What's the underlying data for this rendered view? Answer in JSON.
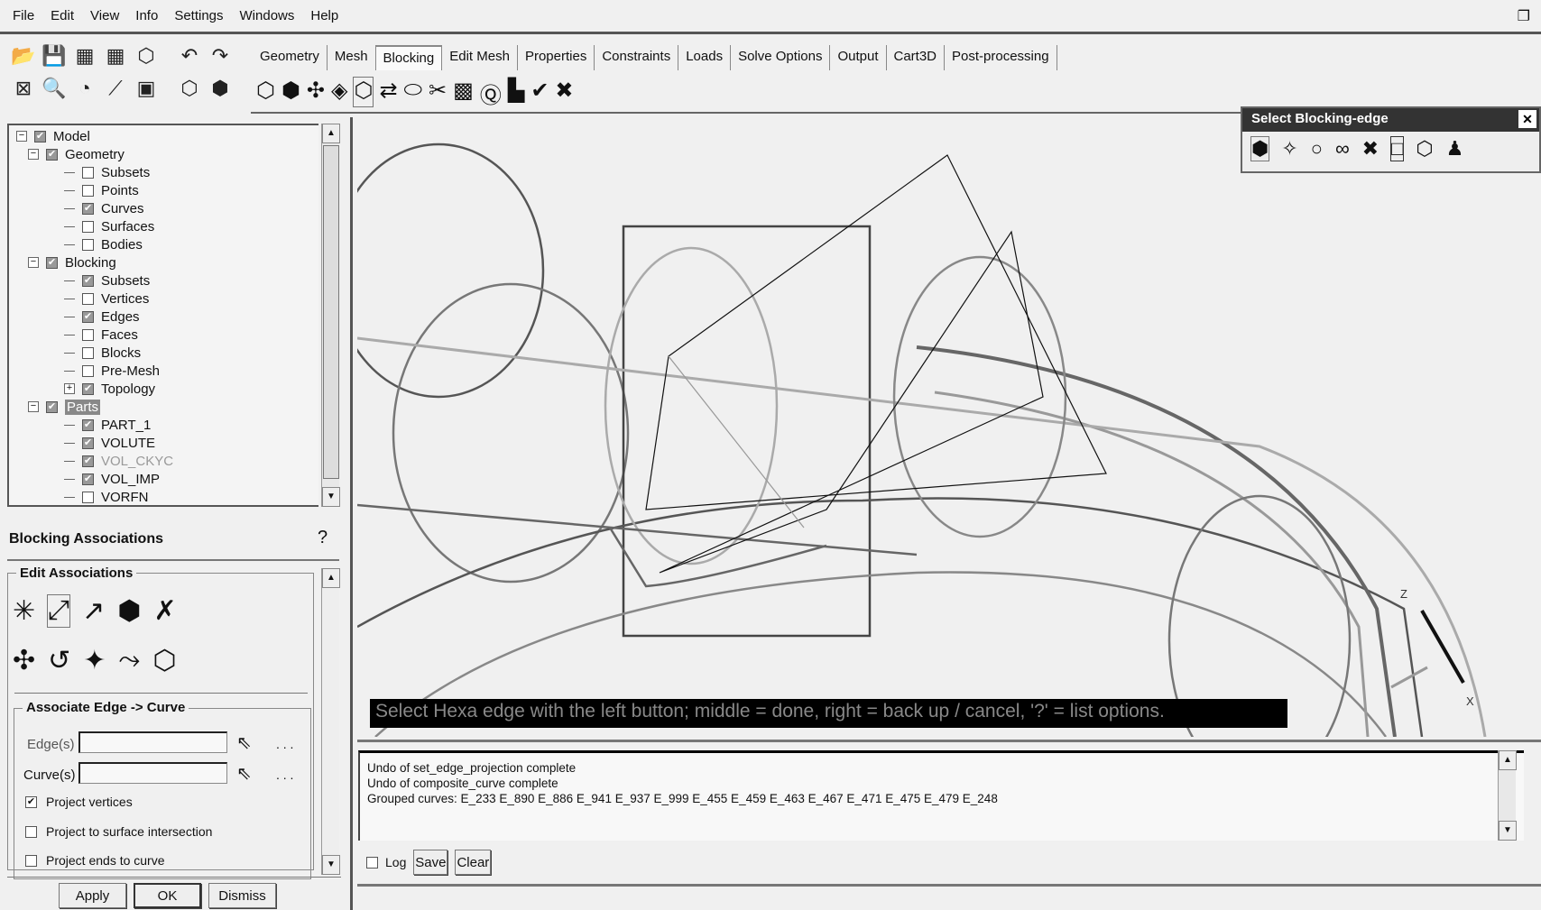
{
  "menu": [
    "File",
    "Edit",
    "View",
    "Info",
    "Settings",
    "Windows",
    "Help"
  ],
  "tabs": [
    "Geometry",
    "Mesh",
    "Blocking",
    "Edit Mesh",
    "Properties",
    "Constraints",
    "Loads",
    "Solve Options",
    "Output",
    "Cart3D",
    "Post-processing"
  ],
  "active_tab": "Blocking",
  "tree": [
    {
      "label": "Model",
      "level": 0,
      "checked": true,
      "expander": "minus"
    },
    {
      "label": "Geometry",
      "level": 1,
      "checked": true,
      "expander": "minus"
    },
    {
      "label": "Subsets",
      "level": 2,
      "checked": false
    },
    {
      "label": "Points",
      "level": 2,
      "checked": false
    },
    {
      "label": "Curves",
      "level": 2,
      "checked": true
    },
    {
      "label": "Surfaces",
      "level": 2,
      "checked": false
    },
    {
      "label": "Bodies",
      "level": 2,
      "checked": false
    },
    {
      "label": "Blocking",
      "level": 1,
      "checked": true,
      "expander": "minus"
    },
    {
      "label": "Subsets",
      "level": 2,
      "checked": true
    },
    {
      "label": "Vertices",
      "level": 2,
      "checked": false
    },
    {
      "label": "Edges",
      "level": 2,
      "checked": true
    },
    {
      "label": "Faces",
      "level": 2,
      "checked": false
    },
    {
      "label": "Blocks",
      "level": 2,
      "checked": false
    },
    {
      "label": "Pre-Mesh",
      "level": 2,
      "checked": false
    },
    {
      "label": "Topology",
      "level": 2,
      "checked": true,
      "expander": "plus"
    },
    {
      "label": "Parts",
      "level": 1,
      "checked": true,
      "expander": "minus",
      "selected": true
    },
    {
      "label": "PART_1",
      "level": 2,
      "checked": true
    },
    {
      "label": "VOLUTE",
      "level": 2,
      "checked": true
    },
    {
      "label": "VOL_CKYC",
      "level": 2,
      "checked": true,
      "dim": true
    },
    {
      "label": "VOL_IMP",
      "level": 2,
      "checked": true
    },
    {
      "label": "VORFN",
      "level": 2,
      "checked": false
    }
  ],
  "assoc": {
    "title": "Blocking Associations",
    "group": "Edit Associations",
    "sub": "Associate Edge -> Curve",
    "edge_label": "Edge(s)",
    "edge_value": "",
    "curve_label": "Curve(s)",
    "curve_value": "",
    "ellipsis": ". . .",
    "options": [
      {
        "label": "Project vertices",
        "checked": true
      },
      {
        "label": "Project to surface intersection",
        "checked": false
      },
      {
        "label": "Project ends to curve",
        "checked": false
      }
    ],
    "apply": "Apply",
    "ok": "OK",
    "dismiss": "Dismiss"
  },
  "select_dialog": {
    "title": "Select Blocking-edge",
    "close": "✕"
  },
  "prompt": "Select Hexa edge with the left button; middle = done, right = back up / cancel, '?' = list options.",
  "axes": {
    "z": "Z",
    "x": "X"
  },
  "messages": [
    "Undo of set_edge_projection complete",
    "Undo of composite_curve complete",
    "Grouped curves: E_233 E_890 E_886 E_941 E_937 E_999 E_455 E_459 E_463 E_467 E_471 E_475 E_479 E_248"
  ],
  "log": {
    "label": "Log",
    "checked": false,
    "save": "Save",
    "clear": "Clear"
  }
}
